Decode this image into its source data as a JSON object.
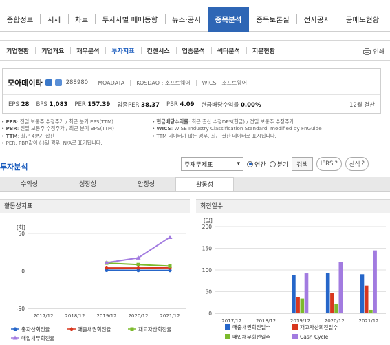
{
  "top_tabs": [
    "종합정보",
    "시세",
    "차트",
    "투자자별 매매동향",
    "뉴스·공시",
    "종목분석",
    "종목토론실",
    "전자공시",
    "공매도현황"
  ],
  "top_active": "종목분석",
  "sub_tabs": [
    "기업현황",
    "기업개요",
    "재무분석",
    "투자지표",
    "컨센서스",
    "업종분석",
    "섹터분석",
    "지분현황"
  ],
  "sub_active": "투자지표",
  "print_label": "인쇄",
  "company": {
    "name": "모아데이타",
    "code": "288980",
    "meta1": "MOADATA",
    "meta2": "KOSDAQ : 소프트웨어",
    "meta3": "WICS : 소프트웨어",
    "eps_label": "EPS",
    "eps": "28",
    "bps_label": "BPS",
    "bps": "1,083",
    "per_label": "PER",
    "per": "157.39",
    "sector_per_label": "업종PER",
    "sector_per": "38.37",
    "pbr_label": "PBR",
    "pbr": "4.09",
    "dividend_label": "현금배당수익률",
    "dividend": "0.00%",
    "settlement": "12월 결산"
  },
  "notes_left": [
    [
      "PER",
      ": 전일 보통주 수정주가 / 최근 분기 EPS(TTM)"
    ],
    [
      "PBR",
      ": 전일 보통주 수정주가 / 최근 분기 BPS(TTM)"
    ],
    [
      "TTM",
      ": 최근 4분기 합산"
    ],
    [
      "",
      "PER, PBR값이 (-)일 경우, N/A로 표기됩니다."
    ]
  ],
  "notes_right": [
    [
      "현금배당수익률",
      ": 최근 결산 수정DPS(현금) / 전일 보통주 수정주가"
    ],
    [
      "WICS",
      ": WISE Industry Classification Standard, modified by FnGuide"
    ],
    [
      "",
      "TTM 데이터가 없는 경우, 최근 결산 데이터로 표시됩니다."
    ]
  ],
  "section_title": "투자분석",
  "select_value": "주재무제표",
  "radio_year": "연간",
  "radio_quarter": "분기",
  "search_btn": "검색",
  "ifrs_btn": "IFRS",
  "formula_btn": "산식",
  "help_icon": "?",
  "analysis_tabs": [
    "수익성",
    "성장성",
    "안정성",
    "활동성"
  ],
  "analysis_active": "활동성",
  "left_chart_title": "활동성지표",
  "right_chart_title": "회전일수",
  "colors": {
    "blue": "#2666c9",
    "red": "#d8371e",
    "green": "#7cba2d",
    "purple": "#a27be0",
    "accent": "#2e66b5"
  },
  "chart_data": [
    {
      "type": "line",
      "title": "활동성지표",
      "ylabel": "[회]",
      "categories": [
        "2017/12",
        "2018/12",
        "2019/12",
        "2020/12",
        "2021/12"
      ],
      "ylim": [
        -50,
        50
      ],
      "yticks": [
        -50,
        0,
        50
      ],
      "series": [
        {
          "name": "총자산회전율",
          "values": [
            null,
            null,
            1.0,
            0.8,
            0.8
          ]
        },
        {
          "name": "매출채권회전율",
          "values": [
            null,
            null,
            4.0,
            4.0,
            4.2
          ]
        },
        {
          "name": "재고자산회전율",
          "values": [
            null,
            null,
            10.5,
            8.5,
            6.5
          ]
        },
        {
          "name": "매입채무회전율",
          "values": [
            null,
            null,
            11.0,
            17.5,
            45.0
          ]
        }
      ]
    },
    {
      "type": "bar",
      "title": "회전일수",
      "ylabel": "[일]",
      "categories": [
        "2017/12",
        "2018/12",
        "2019/12",
        "2020/12",
        "2021/12"
      ],
      "ylim": [
        0,
        200
      ],
      "yticks": [
        0,
        50,
        100,
        150,
        200
      ],
      "series": [
        {
          "name": "매출채권회전일수",
          "values": [
            null,
            null,
            88,
            93,
            90
          ]
        },
        {
          "name": "재고자산회전일수",
          "values": [
            null,
            null,
            38,
            47,
            64
          ]
        },
        {
          "name": "매입채무회전일수",
          "values": [
            null,
            null,
            34,
            21,
            8
          ]
        },
        {
          "name": "Cash Cycle",
          "values": [
            null,
            null,
            92,
            118,
            145
          ]
        }
      ]
    }
  ]
}
